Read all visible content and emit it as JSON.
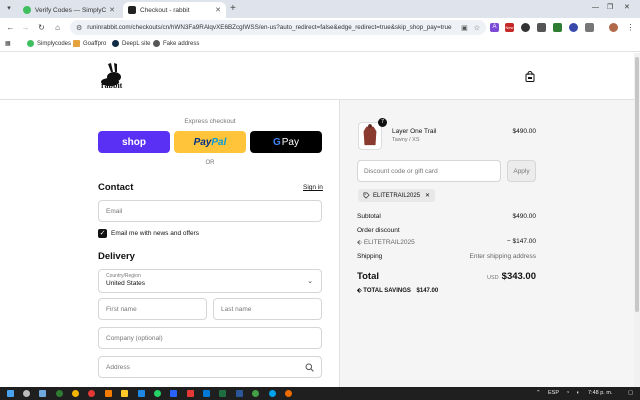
{
  "browser": {
    "tabs": [
      {
        "title": "Verify Codes — SimplyCodes",
        "active": false
      },
      {
        "title": "Checkout - rabbit",
        "active": true
      }
    ],
    "url": "runinrabbit.com/checkouts/cn/hWN3Fa9RAlqvXE6BZcgIWSS/en-us?auto_redirect=false&edge_redirect=true&skip_shop_pay=true",
    "bookmarks": [
      "Simplycodes",
      "Goaffpro",
      "DeepL site",
      "Fake address"
    ],
    "ext_new_badge": "New",
    "ext_letter": "A"
  },
  "header": {
    "logo_text": "rabbit"
  },
  "checkout": {
    "express_label": "Express checkout",
    "shop_label": "shop",
    "paypal_a": "Pay",
    "paypal_b": "Pal",
    "gpay_g": "G",
    "gpay_label": "Pay",
    "or_label": "OR",
    "contact_title": "Contact",
    "signin_label": "Sign in",
    "email_placeholder": "Email",
    "newsletter_label": "Email me with news and offers",
    "delivery_title": "Delivery",
    "country_label": "Country/Region",
    "country_value": "United States",
    "first_name_placeholder": "First name",
    "last_name_placeholder": "Last name",
    "company_placeholder": "Company (optional)",
    "address_placeholder": "Address"
  },
  "summary": {
    "item": {
      "name": "Layer One Trail",
      "variant": "Tawny / XS",
      "price": "$490.00",
      "quantity": "7"
    },
    "code_placeholder": "Discount code or gift card",
    "apply_label": "Apply",
    "applied_code": "ELITETRAIL2025",
    "subtotal_label": "Subtotal",
    "subtotal_value": "$490.00",
    "order_discount_label": "Order discount",
    "discount_code": "ELITETRAIL2025",
    "discount_value": "− $147.00",
    "shipping_label": "Shipping",
    "shipping_value": "Enter shipping address",
    "total_label": "Total",
    "currency": "USD",
    "total_value": "$343.00",
    "savings_label": "TOTAL SAVINGS",
    "savings_value": "$147.00"
  },
  "taskbar": {
    "time": "7:48 p. m.",
    "lang": "ESP"
  },
  "colors": {
    "shop_purple": "#5a31f4",
    "paypal_yellow": "#ffc439",
    "gpay_black": "#000000"
  }
}
